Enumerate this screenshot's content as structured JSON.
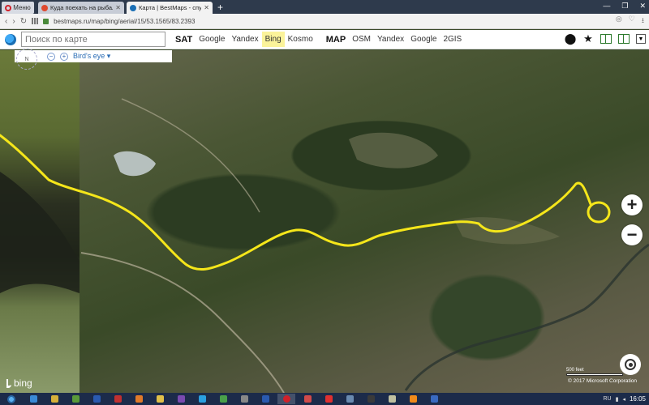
{
  "browser": {
    "menu_label": "Меню",
    "tabs": [
      {
        "title": "Куда поехать на рыбалк",
        "favicon_color": "#e04a2f",
        "active": false
      },
      {
        "title": "Карта | BestMaps - спутн",
        "favicon_color": "#1a6fb5",
        "active": true
      }
    ],
    "new_tab": "+",
    "url": "bestmaps.ru/map/bing/aerial/15/53.1565/83.2393"
  },
  "toolbar": {
    "search_placeholder": "Поиск по карте",
    "sat_label": "SAT",
    "sat_sources": [
      "Google",
      "Yandex",
      "Bing",
      "Kosmo"
    ],
    "sat_selected": "Bing",
    "map_label": "MAP",
    "map_sources": [
      "OSM",
      "Yandex",
      "Google",
      "2GIS"
    ],
    "highlight_color": "#fbf39a"
  },
  "map_controls": {
    "compass_label": "N",
    "birds_eye": "Bird's eye",
    "zoom_in": "+",
    "zoom_out": "−"
  },
  "map": {
    "provider": "bing",
    "scale_label": "500 feet",
    "copyright": "© 2017 Microsoft Corporation",
    "route_color": "#f5e61a"
  },
  "taskbar": {
    "time": "16:05",
    "lang": "RU"
  }
}
